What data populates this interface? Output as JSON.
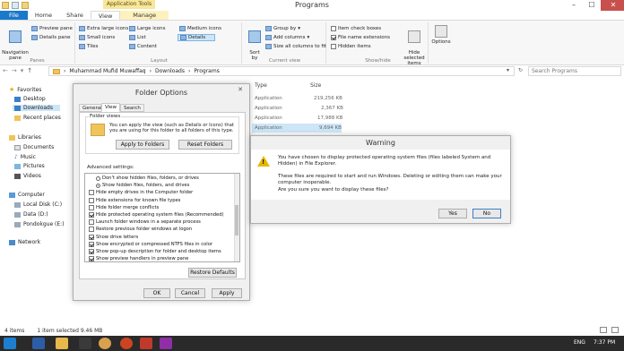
{
  "window": {
    "title": "Programs",
    "context_tab": "Application Tools"
  },
  "ribbon_tabs": [
    {
      "label": "File"
    },
    {
      "label": "Home"
    },
    {
      "label": "Share"
    },
    {
      "label": "View"
    },
    {
      "label": "Manage"
    }
  ],
  "panes": {
    "navigation_pane": "Navigation\npane",
    "preview_pane": "Preview pane",
    "details_pane": "Details pane",
    "label": "Panes"
  },
  "layout": {
    "extra_large_icons": "Extra large icons",
    "large_icons": "Large icons",
    "medium_icons": "Medium icons",
    "small_icons": "Small icons",
    "list": "List",
    "details": "Details",
    "tiles": "Tiles",
    "content": "Content",
    "label": "Layout"
  },
  "current_view": {
    "sort_by": "Sort\nby",
    "group_by": "Group by",
    "add_columns": "Add columns",
    "size_all_columns": "Size all columns to fit",
    "label": "Current view"
  },
  "show_hide": {
    "item_check_boxes": "Item check boxes",
    "file_name_extensions": "File name extensions",
    "hidden_items": "Hidden items",
    "hide_selected": "Hide selected\nitems",
    "label": "Show/hide"
  },
  "options_label": "Options",
  "address": {
    "crumbs": [
      "Muhammad Mufid Muwaffaq",
      "Downloads",
      "Programs"
    ],
    "search_placeholder": "Search Programs"
  },
  "nav": {
    "favorites": "Favorites",
    "desktop": "Desktop",
    "downloads": "Downloads",
    "recent": "Recent places",
    "libraries": "Libraries",
    "documents": "Documents",
    "music": "Music",
    "pictures": "Pictures",
    "videos": "Videos",
    "computer": "Computer",
    "local_disk": "Local Disk (C:)",
    "data": "Data (D:)",
    "pondokgue": "Pondokgue (E:)",
    "network": "Network"
  },
  "file_list": {
    "col_type": "Type",
    "col_size": "Size",
    "rows": [
      {
        "type": "Application",
        "size": "219,256 KB"
      },
      {
        "type": "Application",
        "size": "2,367 KB"
      },
      {
        "type": "Application",
        "size": "17,988 KB"
      },
      {
        "type": "Application",
        "size": "9,694 KB"
      }
    ]
  },
  "folder_options": {
    "title": "Folder Options",
    "tabs": [
      "General",
      "View",
      "Search"
    ],
    "folder_views_label": "Folder views",
    "folder_views_desc": "You can apply the view (such as Details or Icons) that you are using for this folder to all folders of this type.",
    "apply_to_folders": "Apply to Folders",
    "reset_folders": "Reset Folders",
    "advanced_label": "Advanced settings:",
    "settings": [
      {
        "type": "radio",
        "checked": false,
        "label": "Don't show hidden files, folders, or drives"
      },
      {
        "type": "radio",
        "checked": true,
        "label": "Show hidden files, folders, and drives"
      },
      {
        "type": "check",
        "checked": false,
        "label": "Hide empty drives in the Computer folder"
      },
      {
        "type": "check",
        "checked": false,
        "label": "Hide extensions for known file types"
      },
      {
        "type": "check",
        "checked": false,
        "label": "Hide folder merge conflicts"
      },
      {
        "type": "check",
        "checked": true,
        "label": "Hide protected operating system files (Recommended)"
      },
      {
        "type": "check",
        "checked": false,
        "label": "Launch folder windows in a separate process"
      },
      {
        "type": "check",
        "checked": false,
        "label": "Restore previous folder windows at logon"
      },
      {
        "type": "check",
        "checked": true,
        "label": "Show drive letters"
      },
      {
        "type": "check",
        "checked": true,
        "label": "Show encrypted or compressed NTFS files in color"
      },
      {
        "type": "check",
        "checked": true,
        "label": "Show pop-up description for folder and desktop items"
      },
      {
        "type": "check",
        "checked": true,
        "label": "Show preview handlers in preview pane"
      }
    ],
    "restore_defaults": "Restore Defaults",
    "ok": "OK",
    "cancel": "Cancel",
    "apply": "Apply"
  },
  "warning": {
    "title": "Warning",
    "line1": "You have chosen to display protected operating system files (files labeled System and Hidden) in File Explorer.",
    "line2": "These files are required to start and run Windows. Deleting or editing them can make your computer inoperable.",
    "line3": "Are you sure you want to display these files?",
    "yes": "Yes",
    "no": "No"
  },
  "status": {
    "items": "4 items",
    "selected": "1 item selected  9.46 MB"
  },
  "taskbar": {
    "lang": "ENG",
    "time": "7:37 PM"
  }
}
